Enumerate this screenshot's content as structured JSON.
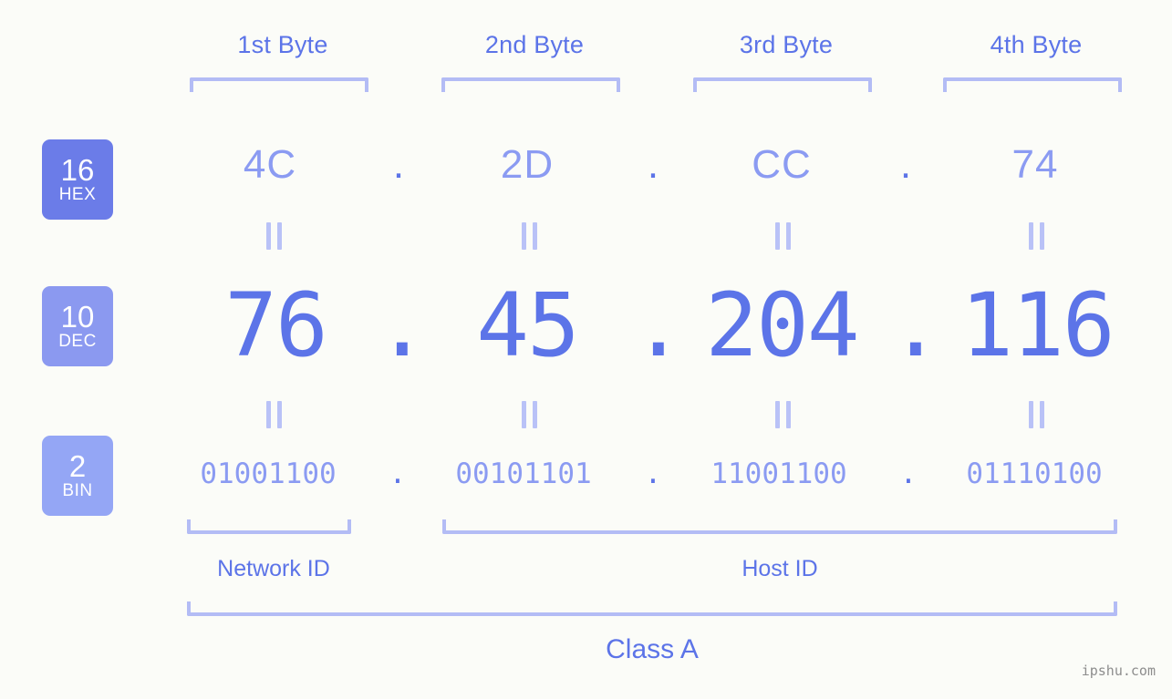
{
  "bytes": {
    "headers": [
      {
        "label": "1st Byte"
      },
      {
        "label": "2nd Byte"
      },
      {
        "label": "3rd Byte"
      },
      {
        "label": "4th Byte"
      }
    ]
  },
  "bases": [
    {
      "number": "16",
      "abbr": "HEX",
      "color": "#6b7ce8"
    },
    {
      "number": "10",
      "abbr": "DEC",
      "color": "#8b99f0"
    },
    {
      "number": "2",
      "abbr": "BIN",
      "color": "#94a6f5"
    }
  ],
  "rows": {
    "hex": {
      "values": [
        "4C",
        "2D",
        "CC",
        "74"
      ],
      "separator": "."
    },
    "dec": {
      "values": [
        "76",
        "45",
        "204",
        "116"
      ],
      "separator": "."
    },
    "bin": {
      "values": [
        "01001100",
        "00101101",
        "11001100",
        "01110100"
      ],
      "separator": "."
    }
  },
  "equals_mark": "||",
  "sections": {
    "network_id": "Network ID",
    "host_id": "Host ID",
    "ip_class": "Class A"
  },
  "watermark": "ipshu.com",
  "colors": {
    "background": "#fbfcf8",
    "accent_strong": "#5c74e8",
    "accent_mid": "#8b9bf2",
    "accent_light": "#b3bcf5",
    "watermark": "#8d8d8d"
  }
}
